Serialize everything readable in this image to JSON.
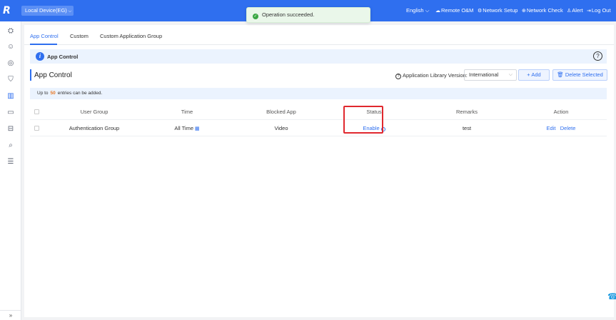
{
  "topbar": {
    "logo": "R",
    "device_select": "Local Device(EG)",
    "language": "English",
    "nav": [
      {
        "label": "Remote O&M",
        "icon": "cloud-icon"
      },
      {
        "label": "Network Setup",
        "icon": "network-icon"
      },
      {
        "label": "Network Check",
        "icon": "check-icon"
      },
      {
        "label": "Alert",
        "icon": "alert-icon"
      },
      {
        "label": "Log Out",
        "icon": "logout-icon"
      }
    ]
  },
  "toast": {
    "message": "Operation succeeded."
  },
  "leftrail": {
    "icons": [
      "topology-icon",
      "user-icon",
      "globe-icon",
      "shield-icon",
      "chart-icon",
      "monitor-icon",
      "toolbox-icon",
      "search-globe-icon",
      "sliders-icon"
    ],
    "toggle": "»"
  },
  "tabs": [
    "App Control",
    "Custom",
    "Custom Application Group"
  ],
  "banner": {
    "title": "App Control"
  },
  "section": {
    "title": "App Control",
    "lib_label": "Application Library Version:",
    "lib_value": "International",
    "add_button": "+ Add",
    "delete_button": "Delete Selected"
  },
  "limit": {
    "prefix": "Up to",
    "count": "50",
    "suffix": "entries can be added."
  },
  "table": {
    "columns": [
      "User Group",
      "Time",
      "Blocked App",
      "Status",
      "Remarks",
      "Action"
    ],
    "rows": [
      {
        "user_group": "Authentication Group",
        "time": "All Time",
        "blocked_app": "Video",
        "status": "Enable",
        "remarks": "test",
        "actions": [
          "Edit",
          "Delete"
        ]
      }
    ]
  },
  "colors": {
    "accent": "#2f6fef",
    "highlight": "#e0282e",
    "success": "#39a743",
    "count": "#e87722"
  }
}
